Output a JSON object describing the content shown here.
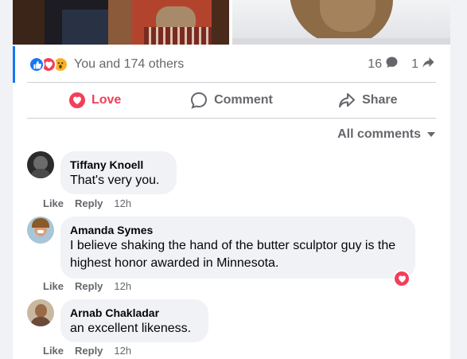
{
  "post": {
    "reaction_summary": "You and 174 others",
    "reaction_icons": [
      "like-icon",
      "love-icon",
      "wow-icon"
    ],
    "comment_count": "16",
    "share_count": "1"
  },
  "actions": {
    "love_label": "Love",
    "comment_label": "Comment",
    "share_label": "Share"
  },
  "sort": {
    "label": "All comments"
  },
  "comments": [
    {
      "author": "Tiffany Knoell",
      "text": "That's very you.",
      "like": "Like",
      "reply": "Reply",
      "time": "12h"
    },
    {
      "author": "Amanda Symes",
      "text": "I believe shaking the hand of the butter sculptor guy is the highest honor awarded in Minnesota.",
      "like": "Like",
      "reply": "Reply",
      "time": "12h",
      "reaction": "love-icon"
    },
    {
      "author": "Arnab Chakladar",
      "text": "an excellent likeness.",
      "like": "Like",
      "reply": "Reply",
      "time": "12h"
    }
  ],
  "colors": {
    "accent": "#1877f2",
    "love": "#f33e58",
    "wow": "#f7b125",
    "secondary_text": "#65676b"
  }
}
